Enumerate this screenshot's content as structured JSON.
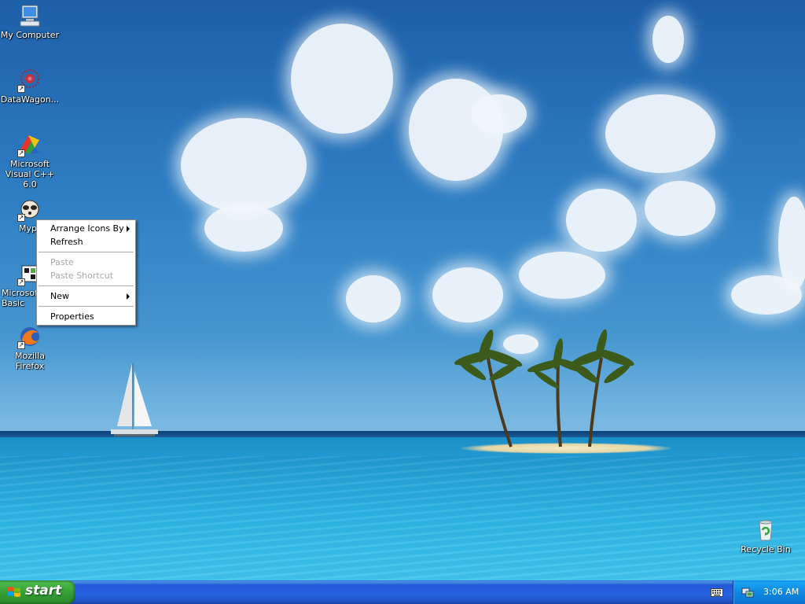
{
  "desktop": {
    "icons": [
      {
        "label": "My Computer"
      },
      {
        "label": "DataWagon..."
      },
      {
        "label": "Microsoft Visual C++ 6.0"
      },
      {
        "label": "Myp"
      },
      {
        "label": "Microsoft Basic"
      },
      {
        "label": "Mozilla Firefox"
      },
      {
        "label": "Recycle Bin"
      }
    ]
  },
  "context_menu": {
    "items": [
      {
        "label": "Arrange Icons By",
        "enabled": true,
        "submenu": true
      },
      {
        "label": "Refresh",
        "enabled": true
      },
      {
        "label": "Paste",
        "enabled": false
      },
      {
        "label": "Paste Shortcut",
        "enabled": false
      },
      {
        "label": "New",
        "enabled": true,
        "submenu": true
      },
      {
        "label": "Properties",
        "enabled": true
      }
    ]
  },
  "taskbar": {
    "start_label": "start",
    "clock": "3:06 AM"
  },
  "colors": {
    "taskbar_blue": "#2663e0",
    "start_green": "#36a136",
    "tray_blue": "#0f88e2",
    "menu_disabled": "#a7a6aa"
  },
  "icons": [
    "monitor-icon",
    "datawagon-icon",
    "visual-cpp-icon",
    "myp-icon",
    "vb-icon",
    "firefox-icon",
    "recycle-bin-icon",
    "windows-flag-icon",
    "keyboard-icon",
    "network-icon"
  ]
}
